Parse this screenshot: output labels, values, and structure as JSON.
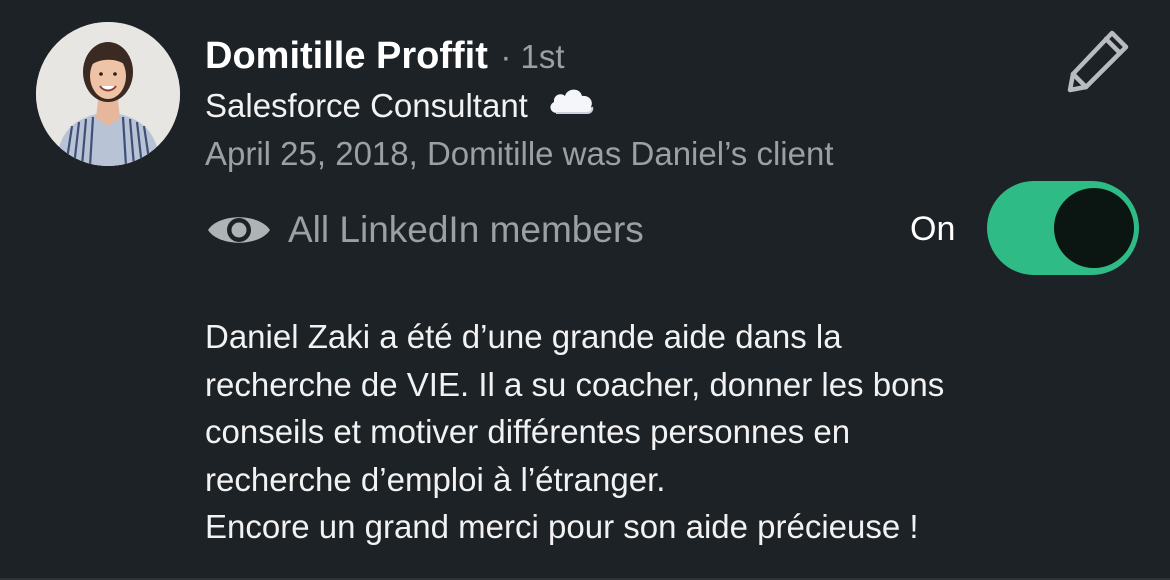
{
  "recommendation": {
    "recommender_name": "Domitille Proffit",
    "connection_degree": "· 1st",
    "headline": "Salesforce Consultant",
    "headline_emoji_icon": "cloud-icon",
    "meta": "April 25, 2018, Domitille was Daniel’s client",
    "visibility": {
      "icon": "eye-icon",
      "label": "All LinkedIn members",
      "toggle_label": "On",
      "toggle_on": true
    },
    "text_lines": [
      "Daniel Zaki a été d’une grande aide dans la",
      "recherche de VIE. Il a su coacher, donner les bons",
      "conseils et motiver différentes personnes en",
      "recherche d’emploi à l’étranger.",
      "Encore un grand merci pour son aide précieuse !"
    ]
  },
  "actions": {
    "edit_icon": "pencil-icon"
  },
  "colors": {
    "background": "#1d2226",
    "toggle_track": "#2fbb85",
    "secondary_text": "#9aa0a4"
  }
}
